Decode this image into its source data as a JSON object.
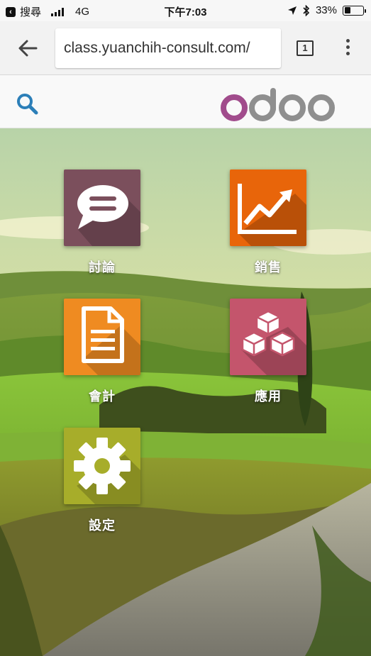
{
  "status_bar": {
    "carrier_back_label": "搜尋",
    "network": "4G",
    "time": "下午7:03",
    "battery_text": "33%",
    "battery_level": 0.33
  },
  "browser": {
    "url": "class.yuanchih-consult.com/",
    "tab_count": "1"
  },
  "header": {
    "logo_text": "odoo",
    "logo_color": "#875a7b"
  },
  "apps": [
    {
      "label": "討論",
      "color": "#7b4f5c",
      "icon": "discuss-chat-icon"
    },
    {
      "label": "銷售",
      "color": "#e8650a",
      "icon": "sales-chart-icon"
    },
    {
      "label": "會計",
      "color": "#ef8b21",
      "icon": "accounting-document-icon"
    },
    {
      "label": "應用",
      "color": "#c4556c",
      "icon": "apps-cubes-icon"
    },
    {
      "label": "設定",
      "color": "#a7ad2a",
      "icon": "settings-gear-icon"
    }
  ]
}
